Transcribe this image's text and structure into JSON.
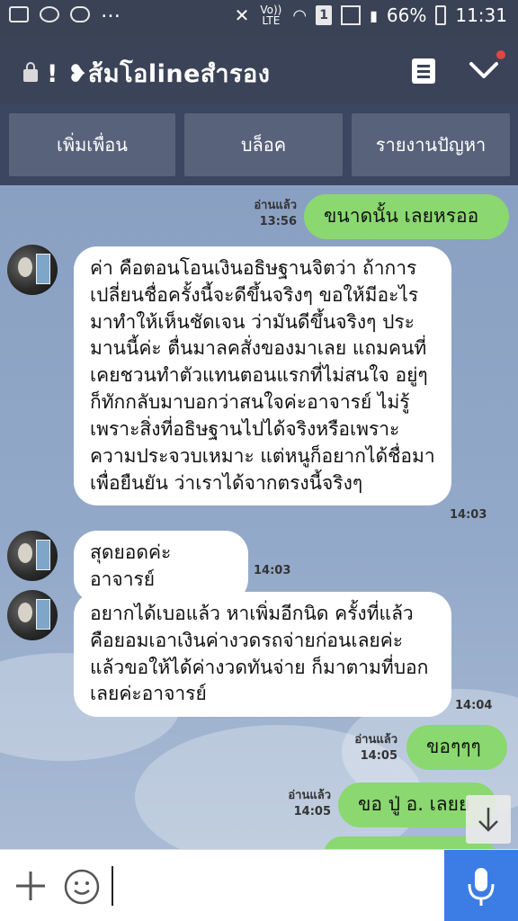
{
  "status_bar": {
    "network_label": "Vo)) LTE",
    "sim_slot": "1",
    "battery": "66%",
    "time": "11:31"
  },
  "header": {
    "title": "! ❥ส้มโอlineสำรอง"
  },
  "actions": {
    "add_friend": "เพิ่มเพื่อน",
    "block": "บล็อค",
    "report": "รายงานปัญหา"
  },
  "messages": [
    {
      "side": "out",
      "text": "ขนาดนั้น เลยหรออ",
      "read": "อ่านแล้ว",
      "time": "13:56"
    },
    {
      "side": "in",
      "text": "ค่า คือตอนโอนเงินอธิษฐานจิตว่า ถ้าการเปลี่ยนชื่อครั้งนี้จะดีขึ้นจริงๆ ขอให้มีอะไรมาทำให้เห็นชัดเจน ว่ามันดีขึ้นจริงๆ ประมานนี้ค่ะ ตื่นมาลคสั่งของมาเลย แถมคนที่เคยชวนทำตัวแทนตอนแรกที่ไม่สนใจ อยู่ๆก็ทักกลับมาบอกว่าสนใจค่ะอาจารย์ ไม่รู้เพราะสิ่งที่อธิษฐานไปได้จริงหรือเพราะความประจวบเหมาะ แต่หนูก็อยากได้ชื่อมาเพื่อยืนยัน ว่าเราได้จากตรงนี้จริงๆ",
      "time": "14:03"
    },
    {
      "side": "in",
      "text": "สุดยอดค่ะอาจารย์",
      "time": "14:03"
    },
    {
      "side": "in",
      "text": "อยากได้เบอแล้ว หาเพิ่มอีกนิด ครั้งที่แล้ว คือยอมเอาเงินค่างวดรถจ่ายก่อนเลยค่ะ แล้วขอให้ได้ค่างวดทันจ่าย ก็มาตามที่บอกเลยค่ะอาจารย์",
      "time": "14:04"
    },
    {
      "side": "out",
      "text": "ขอๆๆๆ",
      "read": "อ่านแล้ว",
      "time": "14:05"
    },
    {
      "side": "out",
      "text": "ขอ ปู่ อ. เลยย",
      "read": "อ่านแล้ว",
      "time": "14:05"
    }
  ],
  "input": {
    "placeholder": ""
  }
}
